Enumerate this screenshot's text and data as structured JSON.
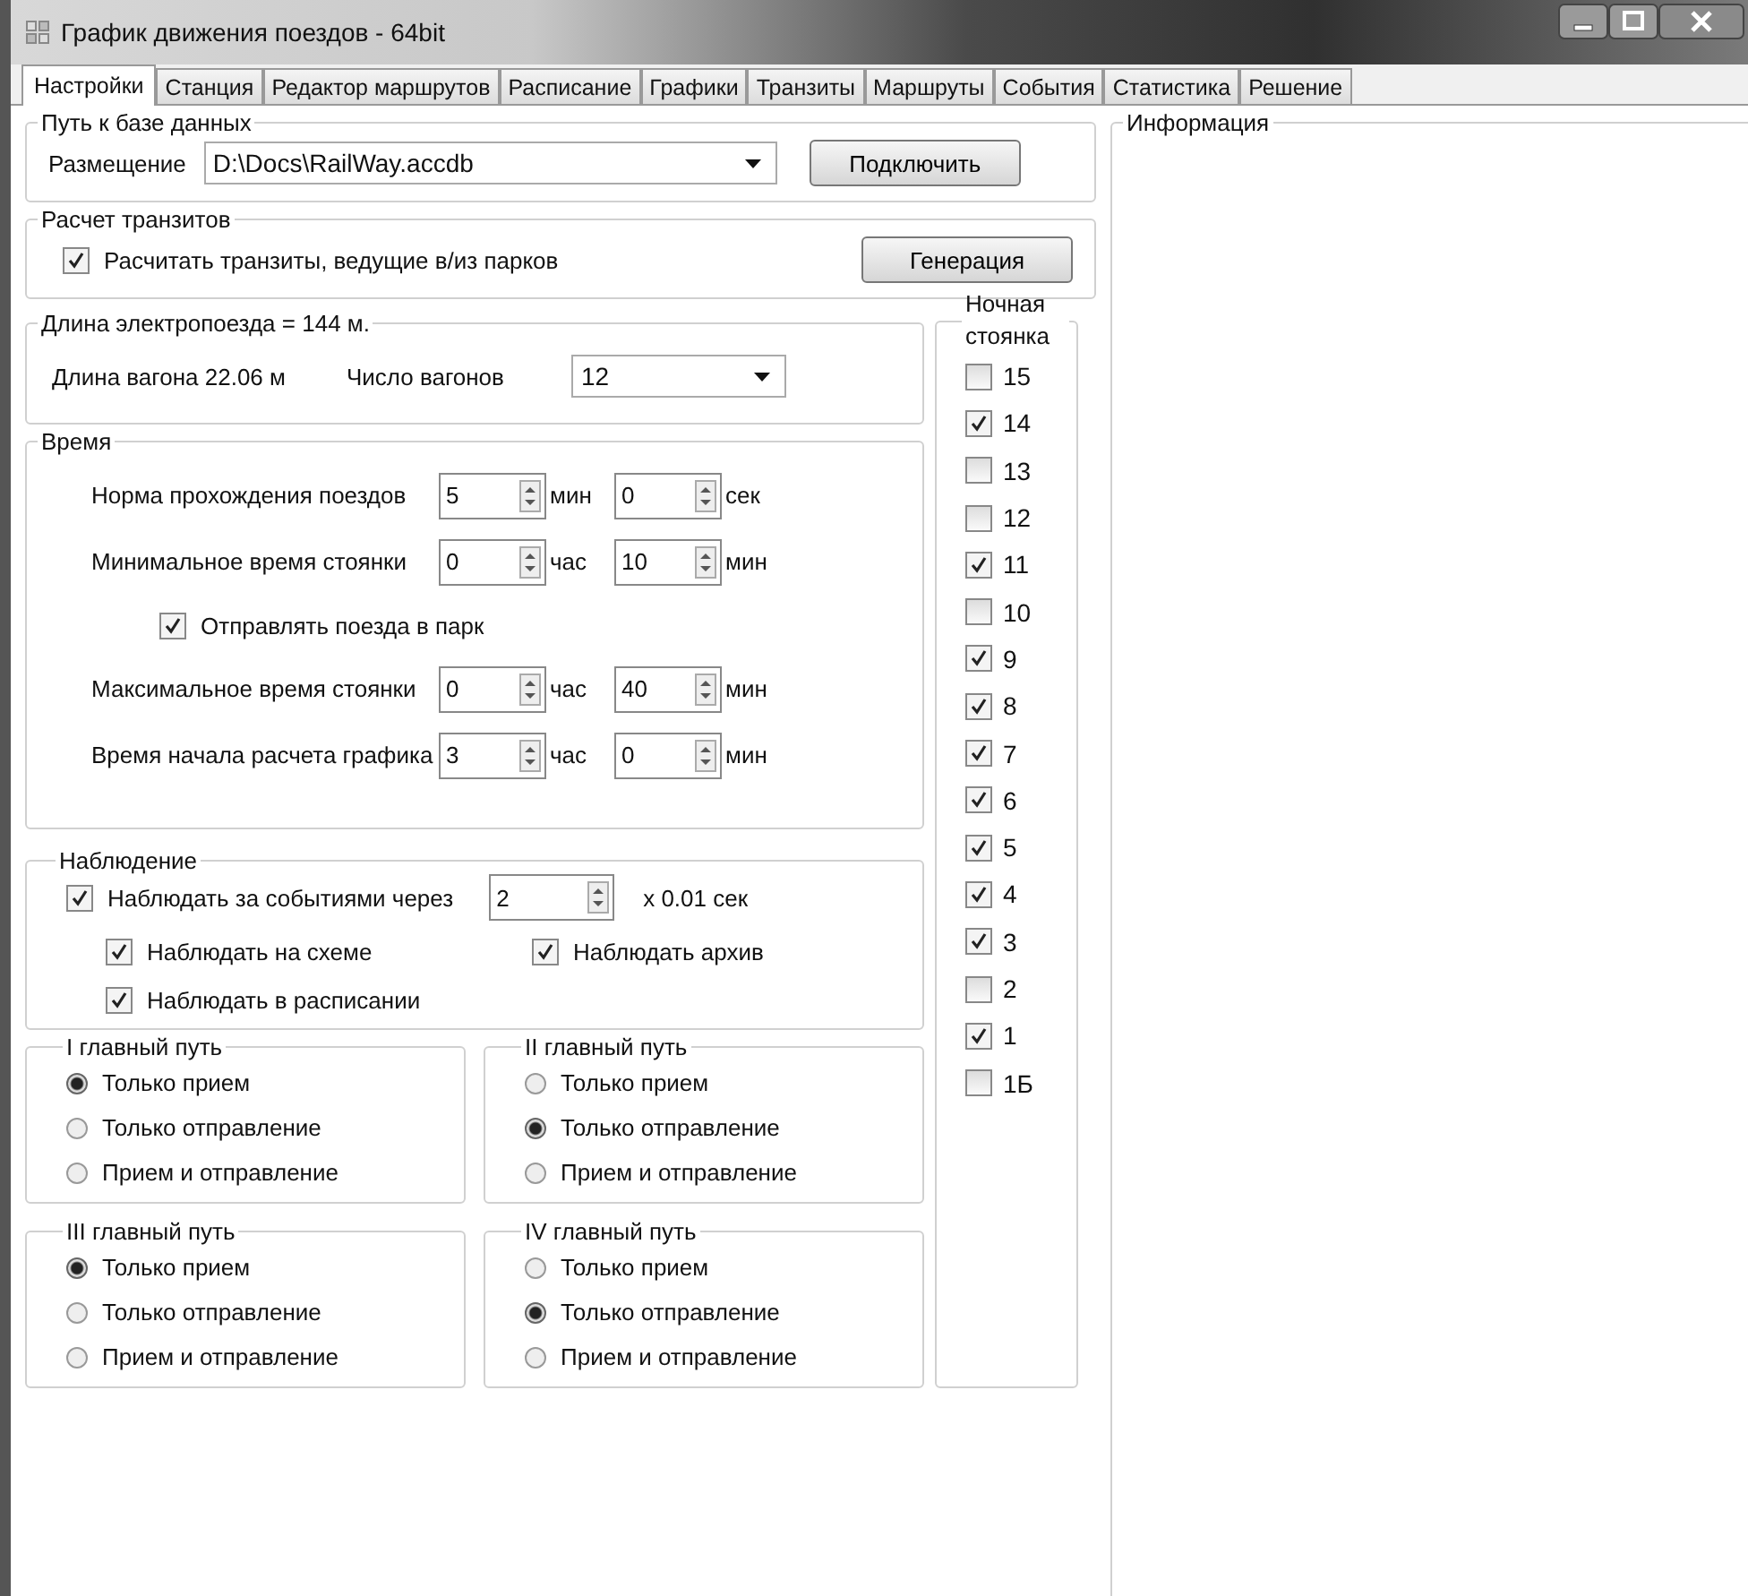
{
  "window": {
    "title": "График движения поездов - 64bit"
  },
  "tabs": [
    {
      "label": "Настройки",
      "selected": true
    },
    {
      "label": "Станция",
      "selected": false
    },
    {
      "label": "Редактор маршрутов",
      "selected": false
    },
    {
      "label": "Расписание",
      "selected": false
    },
    {
      "label": "Графики",
      "selected": false
    },
    {
      "label": "Транзиты",
      "selected": false
    },
    {
      "label": "Маршруты",
      "selected": false
    },
    {
      "label": "События",
      "selected": false
    },
    {
      "label": "Статистика",
      "selected": false
    },
    {
      "label": "Решение",
      "selected": false
    }
  ],
  "db_path": {
    "title": "Путь к базе данных",
    "label": "Размещение",
    "value": "D:\\Docs\\RailWay.accdb",
    "button": "Подключить"
  },
  "transits": {
    "title": "Расчет транзитов",
    "option": {
      "label": "Расчитать транзиты, ведущие в/из парков",
      "checked": true
    },
    "button": "Генерация"
  },
  "train_length": {
    "title": "Длина электропоезда = 144 м.",
    "car_length": "Длина вагона 22.06 м",
    "cars_label": "Число вагонов",
    "cars_value": "12"
  },
  "time": {
    "title": "Время",
    "rows": [
      {
        "kind": "spin",
        "label": "Норма прохождения поездов",
        "fields": [
          {
            "value": "5",
            "unit": "мин"
          },
          {
            "value": "0",
            "unit": "сек"
          }
        ]
      },
      {
        "kind": "spin",
        "label": "Минимальное время стоянки",
        "fields": [
          {
            "value": "0",
            "unit": "час"
          },
          {
            "value": "10",
            "unit": "мин"
          }
        ]
      },
      {
        "kind": "checkbox",
        "label": "Отправлять поезда в парк",
        "checked": true
      },
      {
        "kind": "spin",
        "label": "Максимальное время стоянки",
        "fields": [
          {
            "value": "0",
            "unit": "час"
          },
          {
            "value": "40",
            "unit": "мин"
          }
        ]
      },
      {
        "kind": "spin",
        "label": "Время начала расчета графика",
        "fields": [
          {
            "value": "3",
            "unit": "час"
          },
          {
            "value": "0",
            "unit": "мин"
          }
        ]
      }
    ]
  },
  "observation": {
    "title": "Наблюдение",
    "main": {
      "label": "Наблюдать за событиями через",
      "checked": true,
      "value": "2",
      "unit": "x 0.01 сек"
    },
    "options": [
      {
        "label": "Наблюдать на схеме",
        "checked": true
      },
      {
        "label": "Наблюдать архив",
        "checked": true
      },
      {
        "label": "Наблюдать в расписании",
        "checked": true
      }
    ]
  },
  "main_tracks": [
    {
      "title": "I главный путь",
      "options": [
        {
          "label": "Только прием",
          "selected": true
        },
        {
          "label": "Только отправление",
          "selected": false
        },
        {
          "label": "Прием и отправление",
          "selected": false
        }
      ]
    },
    {
      "title": "II главный путь",
      "options": [
        {
          "label": "Только прием",
          "selected": false
        },
        {
          "label": "Только отправление",
          "selected": true
        },
        {
          "label": "Прием и отправление",
          "selected": false
        }
      ]
    },
    {
      "title": "III главный путь",
      "options": [
        {
          "label": "Только прием",
          "selected": true
        },
        {
          "label": "Только отправление",
          "selected": false
        },
        {
          "label": "Прием и отправление",
          "selected": false
        }
      ]
    },
    {
      "title": "IV главный путь",
      "options": [
        {
          "label": "Только прием",
          "selected": false
        },
        {
          "label": "Только отправление",
          "selected": true
        },
        {
          "label": "Прием и отправление",
          "selected": false
        }
      ]
    }
  ],
  "night_parking": {
    "title": "Ночная стоянка",
    "tracks": [
      {
        "label": "15",
        "checked": false
      },
      {
        "label": "14",
        "checked": true
      },
      {
        "label": "13",
        "checked": false
      },
      {
        "label": "12",
        "checked": false
      },
      {
        "label": "11",
        "checked": true
      },
      {
        "label": "10",
        "checked": false
      },
      {
        "label": "9",
        "checked": true
      },
      {
        "label": "8",
        "checked": true
      },
      {
        "label": "7",
        "checked": true
      },
      {
        "label": "6",
        "checked": true
      },
      {
        "label": "5",
        "checked": true
      },
      {
        "label": "4",
        "checked": true
      },
      {
        "label": "3",
        "checked": true
      },
      {
        "label": "2",
        "checked": false
      },
      {
        "label": "1",
        "checked": true
      },
      {
        "label": "1Б",
        "checked": false
      }
    ]
  },
  "info": {
    "title": "Информация"
  }
}
